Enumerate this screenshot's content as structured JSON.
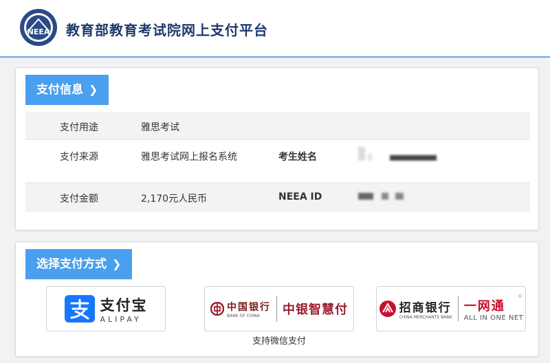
{
  "header": {
    "logo_text": "NEEA",
    "title": "教育部教育考试院网上支付平台"
  },
  "payment_info": {
    "tab_label": "支付信息",
    "rows": [
      {
        "label": "支付用途",
        "value": "雅思考试"
      },
      {
        "label": "支付来源",
        "value": "雅思考试网上报名系统",
        "label2": "考生姓名"
      },
      {
        "label": "支付金额",
        "value": "2,170元人民币",
        "label2": "NEEA ID"
      }
    ]
  },
  "payment_method": {
    "tab_label": "选择支付方式",
    "alipay": {
      "cn": "支付宝",
      "en": "ALIPAY"
    },
    "boc": {
      "cn": "中国银行",
      "en": "BANK OF CHINA",
      "product": "中银智慧付"
    },
    "cmb": {
      "cn": "招商银行",
      "en": "CHINA MERCHANTS BANK",
      "product": "一网通",
      "product_en": "ALL IN ONE NET"
    },
    "wechat_note": "支持微信支付"
  },
  "colors": {
    "accent": "#4a9fee",
    "header_title": "#1e3a6e",
    "alipay_blue": "#1677ff"
  }
}
